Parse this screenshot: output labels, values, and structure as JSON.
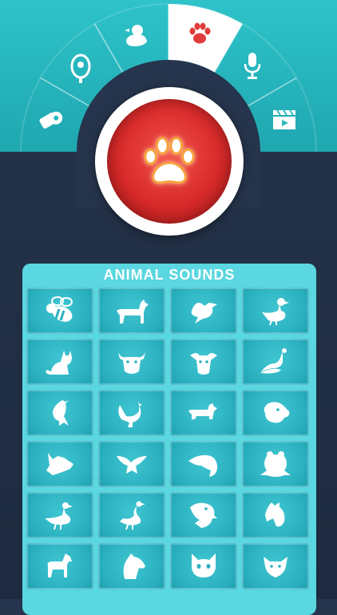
{
  "panel": {
    "title": "ANIMAL SOUNDS"
  },
  "dial": {
    "segments": [
      {
        "icon": "whistle-icon"
      },
      {
        "icon": "bell-icon"
      },
      {
        "icon": "duck-icon"
      },
      {
        "icon": "paw-icon",
        "active": true
      },
      {
        "icon": "microphone-icon"
      },
      {
        "icon": "clapperboard-icon"
      }
    ],
    "center_icon": "paw-icon"
  },
  "tiles": [
    {
      "icon": "bee-icon"
    },
    {
      "icon": "dog-icon"
    },
    {
      "icon": "bird-icon"
    },
    {
      "icon": "duck-icon"
    },
    {
      "icon": "cat-icon"
    },
    {
      "icon": "bull-icon"
    },
    {
      "icon": "sheep-icon"
    },
    {
      "icon": "peacock-icon"
    },
    {
      "icon": "crow-icon"
    },
    {
      "icon": "rooster-icon"
    },
    {
      "icon": "small-dog-icon"
    },
    {
      "icon": "dog-head-icon"
    },
    {
      "icon": "wolf-icon"
    },
    {
      "icon": "dove-icon"
    },
    {
      "icon": "eagle-head-icon"
    },
    {
      "icon": "frog-icon"
    },
    {
      "icon": "goose-icon"
    },
    {
      "icon": "swan-icon"
    },
    {
      "icon": "eagle-icon"
    },
    {
      "icon": "horse-head-icon"
    },
    {
      "icon": "horse-icon"
    },
    {
      "icon": "horse-bust-icon"
    },
    {
      "icon": "cat-face-icon"
    },
    {
      "icon": "fox-icon"
    }
  ],
  "colors": {
    "accent": "#2ec3c9",
    "active": "#e23b3b",
    "background": "#26354d"
  }
}
